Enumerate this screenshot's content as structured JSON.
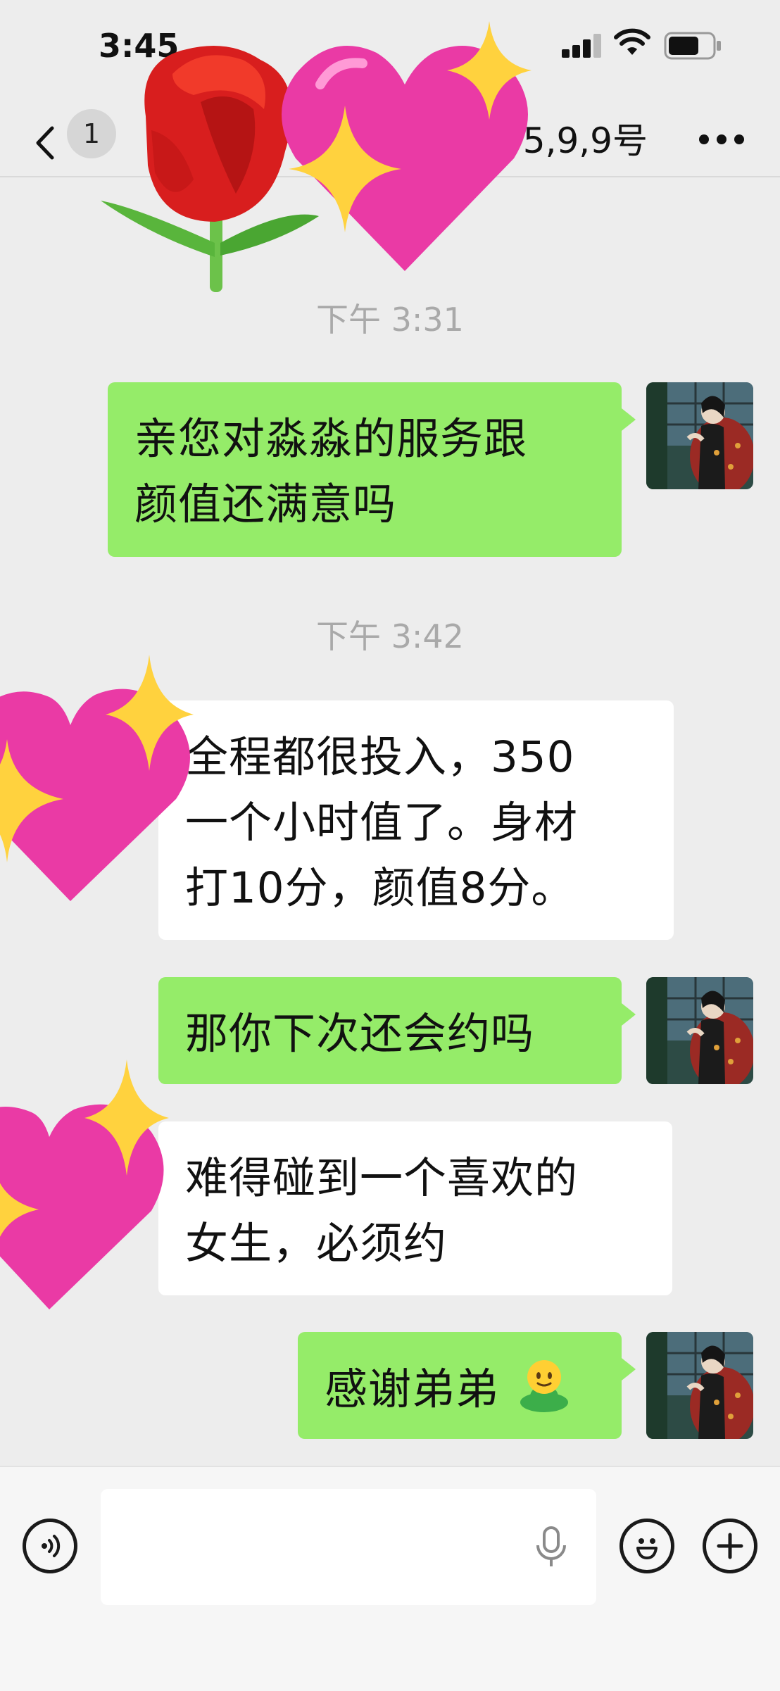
{
  "status_bar": {
    "time": "3:45"
  },
  "nav": {
    "back_count": "1",
    "title": "5,9,9号"
  },
  "messages": [
    {
      "type": "time",
      "text": "下午 3:31"
    },
    {
      "type": "outgoing",
      "lines": [
        "亲您对淼淼的服务跟",
        "颜值还满意吗"
      ]
    },
    {
      "type": "time",
      "text": "下午 3:42"
    },
    {
      "type": "incoming",
      "lines": [
        "全程都很投入，350",
        "一个小时值了。身材",
        "打10分，颜值8分。"
      ]
    },
    {
      "type": "outgoing",
      "lines": [
        "那你下次还会约吗"
      ]
    },
    {
      "type": "incoming",
      "lines": [
        "难得碰到一个喜欢的",
        "女生，必须约"
      ]
    },
    {
      "type": "outgoing",
      "lines": [
        "感谢弟弟"
      ],
      "emoji": "smiling-person-emoji"
    }
  ],
  "input_bar": {
    "voice_icon": "voice-mode-icon",
    "mic_icon": "microphone-icon",
    "emoji_icon": "emoji-icon",
    "plus_icon": "plus-icon"
  },
  "stickers": [
    "rose-emoji",
    "sparkling-heart-emoji",
    "sparkling-heart-emoji",
    "sparkling-heart-emoji"
  ],
  "colors": {
    "outgoing_bubble": "#95ec69",
    "incoming_bubble": "#ffffff",
    "background": "#ededed",
    "heart": "#ea3aa5",
    "sparkle": "#ffd23e"
  }
}
